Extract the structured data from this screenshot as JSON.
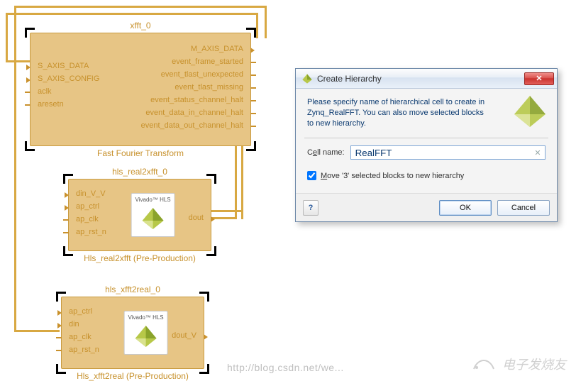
{
  "blocks": {
    "xfft0": {
      "title": "xfft_0",
      "subtitle": "Fast Fourier Transform",
      "ports_left": [
        "S_AXIS_DATA",
        "S_AXIS_CONFIG",
        "aclk",
        "aresetn"
      ],
      "ports_right": [
        "M_AXIS_DATA",
        "event_frame_started",
        "event_tlast_unexpected",
        "event_tlast_missing",
        "event_status_channel_halt",
        "event_data_in_channel_halt",
        "event_data_out_channel_halt"
      ]
    },
    "r2x0": {
      "title": "hls_real2xfft_0",
      "subtitle": "Hls_real2xfft (Pre-Production)",
      "inner_label": "Vivado™ HLS",
      "ports_left": [
        "din_V_V",
        "ap_ctrl",
        "ap_clk",
        "ap_rst_n"
      ],
      "ports_right": [
        "dout"
      ]
    },
    "x2r0": {
      "title": "hls_xfft2real_0",
      "subtitle": "Hls_xfft2real (Pre-Production)",
      "inner_label": "Vivado™ HLS",
      "ports_left": [
        "ap_ctrl",
        "din",
        "ap_clk",
        "ap_rst_n"
      ],
      "ports_right": [
        "dout_V"
      ]
    }
  },
  "dialog": {
    "title": "Create Hierarchy",
    "instructions": "Please specify name of hierarchical cell to create in Zynq_RealFFT. You can also move selected blocks to new hierarchy.",
    "cell_name_label_pre": "C",
    "cell_name_label_ul": "e",
    "cell_name_label_post": "ll name:",
    "cell_name_value": "RealFFT",
    "move_label_ul": "M",
    "move_label_post": "ove '3' selected blocks to new hierarchy",
    "move_checked": true,
    "help_glyph": "?",
    "ok_label": "OK",
    "cancel_label": "Cancel",
    "close_glyph": "✕"
  },
  "watermarks": {
    "url": "http://blog.csdn.net/we...",
    "brand": "电子发烧友"
  }
}
